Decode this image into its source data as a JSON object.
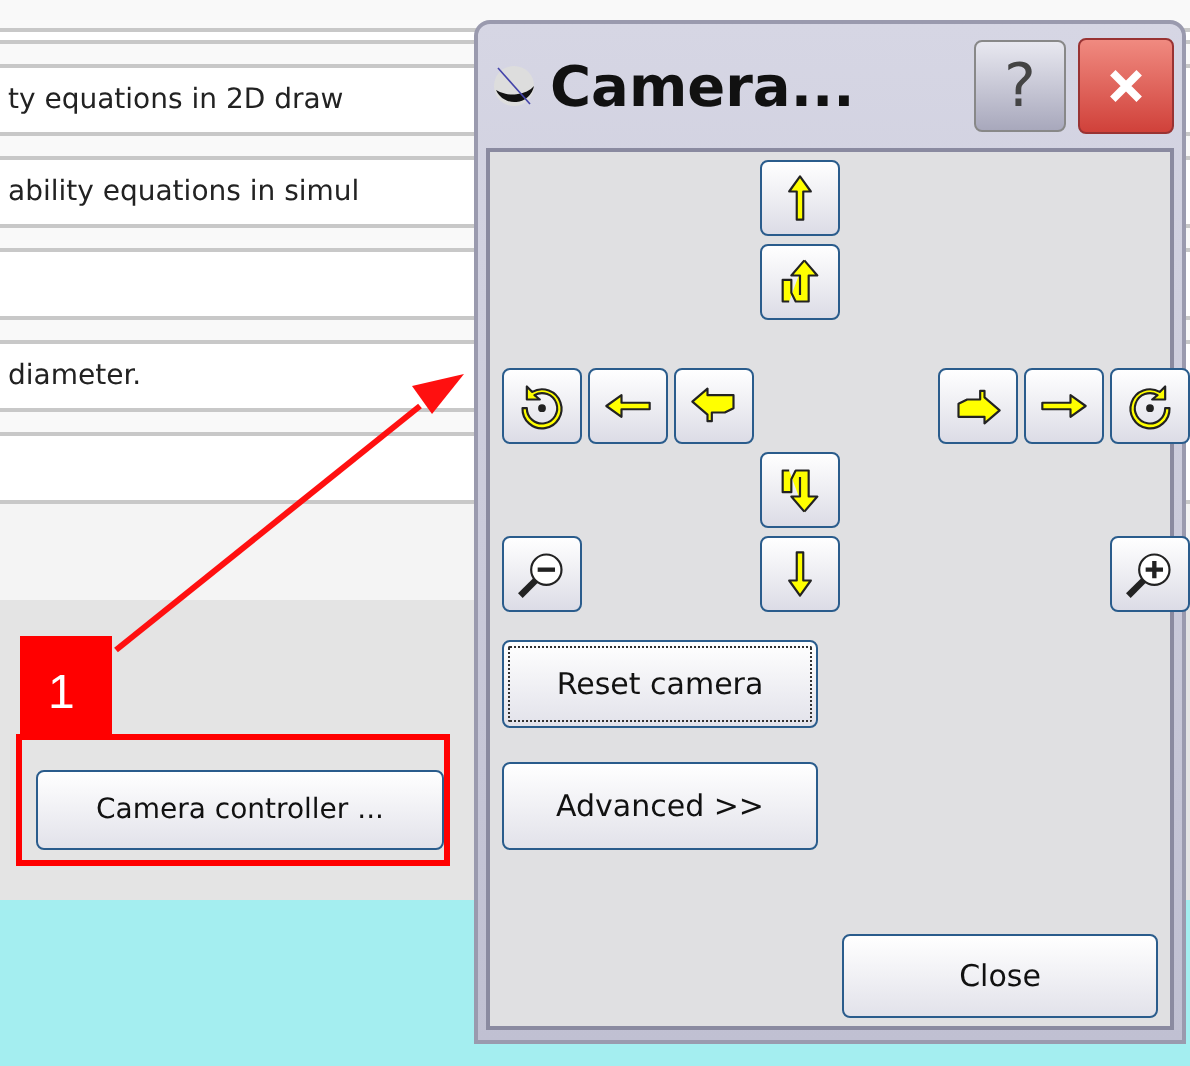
{
  "background_list": {
    "rows": [
      {
        "text": ""
      },
      {
        "text": "ty equations in 2D draw"
      },
      {
        "text": "ability equations in simul"
      },
      {
        "text": ""
      },
      {
        "text": "diameter."
      },
      {
        "text": ""
      }
    ]
  },
  "camera_controller_button": {
    "label": "Camera controller ..."
  },
  "callout": {
    "number": "1"
  },
  "dialog": {
    "title": "Camera...",
    "help": "?",
    "nav_buttons": [
      {
        "kind": "up"
      },
      {
        "kind": "tilt-up"
      },
      {
        "kind": "rotate-left"
      },
      {
        "kind": "left"
      },
      {
        "kind": "tilt-left"
      },
      {
        "kind": "tilt-right"
      },
      {
        "kind": "right"
      },
      {
        "kind": "rotate-right"
      },
      {
        "kind": "tilt-down"
      },
      {
        "kind": "zoom-out"
      },
      {
        "kind": "down"
      },
      {
        "kind": "zoom-in"
      }
    ],
    "reset_button": {
      "label": "Reset camera",
      "focused": true
    },
    "advanced_button": {
      "label": "Advanced >>",
      "focused": false
    },
    "close_button": {
      "label": "Close",
      "focused": false
    }
  }
}
